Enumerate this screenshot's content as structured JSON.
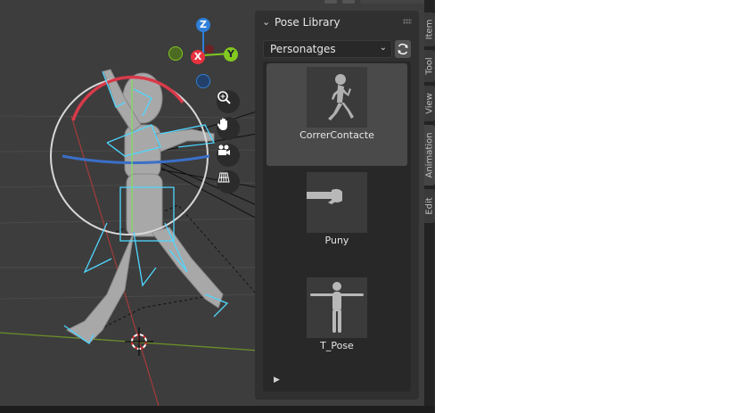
{
  "viewport": {
    "gizmo": {
      "z_label": "Z",
      "y_label": "Y",
      "x_label": "X"
    },
    "nav_buttons": [
      "zoom-icon",
      "pan-hand-icon",
      "camera-icon",
      "grid-icon"
    ]
  },
  "panel": {
    "title": "Pose Library",
    "collection": {
      "selected": "Personatges"
    },
    "poses": [
      {
        "name": "CorrerContacte",
        "active": true
      },
      {
        "name": "Puny",
        "active": false
      },
      {
        "name": "T_Pose",
        "active": false
      }
    ]
  },
  "tabs": [
    "Item",
    "Tool",
    "View",
    "Animation",
    "Edit"
  ],
  "colors": {
    "accent_selected": "#4a4a4a",
    "axis_x": "#e8323f",
    "axis_y": "#82c81f",
    "axis_z": "#2f7fd8"
  }
}
